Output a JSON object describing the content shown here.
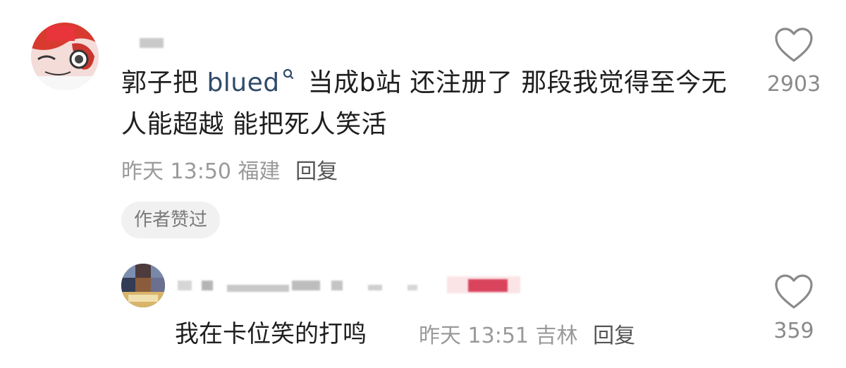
{
  "main_comment": {
    "text_before": "郭子把 ",
    "link_text": "blued",
    "text_after": " 当成b站 还注册了 那段我觉得至今无人能超越 能把死人笑活",
    "time": "昨天 13:50",
    "location": "福建",
    "reply_label": "回复",
    "author_liked_badge": "作者赞过",
    "likes": "2903"
  },
  "reply_comment": {
    "text": "我在卡位笑的打鸣",
    "time": "昨天 13:51",
    "location": "吉林",
    "reply_label": "回复",
    "likes": "359"
  },
  "icons": {
    "like": "heart-outline-icon",
    "search": "search-icon"
  },
  "colors": {
    "link": "#2f4a6b",
    "meta": "#9a9a9a",
    "badge_bg": "#f1f1f1"
  }
}
